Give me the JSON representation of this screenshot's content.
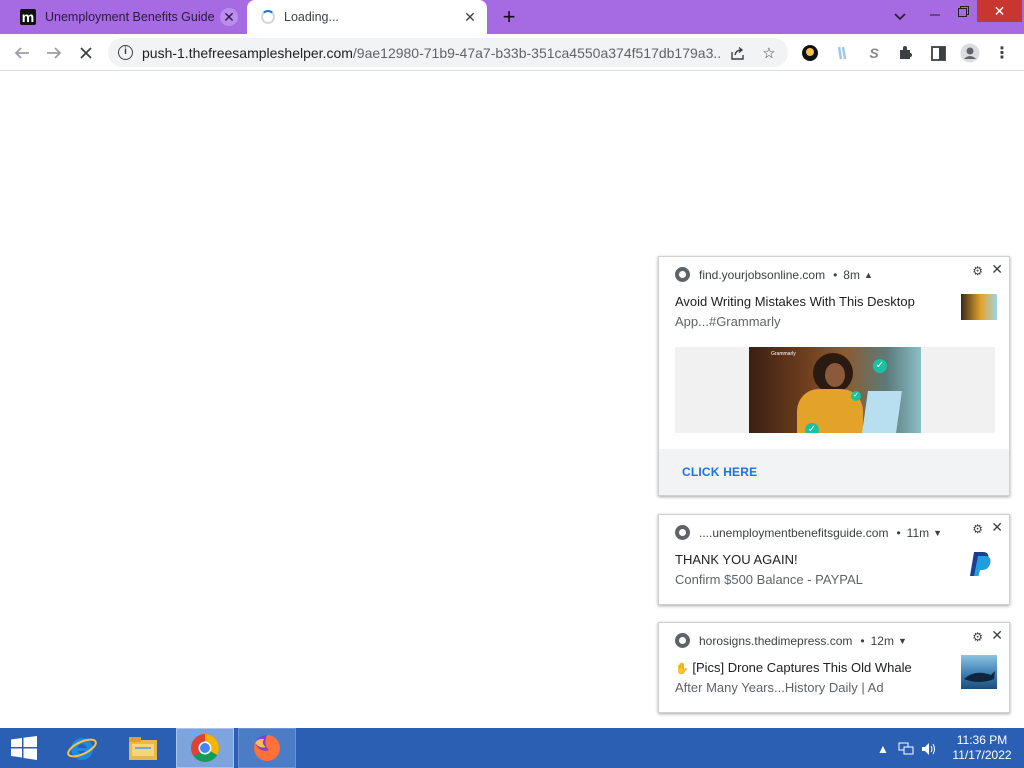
{
  "browser": {
    "tabs": [
      {
        "title": "Unemployment Benefits Guide",
        "favicon": "m-logo",
        "active": false
      },
      {
        "title": "Loading...",
        "favicon": "loading-spinner",
        "active": true
      }
    ],
    "url_host": "push-1.thefreesampleshelper.com",
    "url_path": "/9ae12980-71b9-47a7-b33b-351ca4550a374f517db179a3...",
    "accent_color": "#a66ae2"
  },
  "notifications": [
    {
      "source": "find.yourjobsonline.com",
      "time": "8m",
      "title": "Avoid Writing Mistakes With This Desktop",
      "body": "App...#Grammarly",
      "image_brand": "Grammarly",
      "action": "CLICK HERE"
    },
    {
      "source": "....unemploymentbenefitsguide.com",
      "time": "11m",
      "title": "THANK YOU AGAIN!",
      "body": "Confirm $500 Balance - PAYPAL",
      "icon": "paypal-icon"
    },
    {
      "source": "horosigns.thedimepress.com",
      "time": "12m",
      "title": "[Pics] Drone Captures This Old Whale",
      "body": "After Many Years...History Daily | Ad",
      "icon": "whale-thumbnail"
    }
  ],
  "taskbar": {
    "time": "11:36 PM",
    "date": "11/17/2022",
    "color": "#2b5fb4"
  }
}
